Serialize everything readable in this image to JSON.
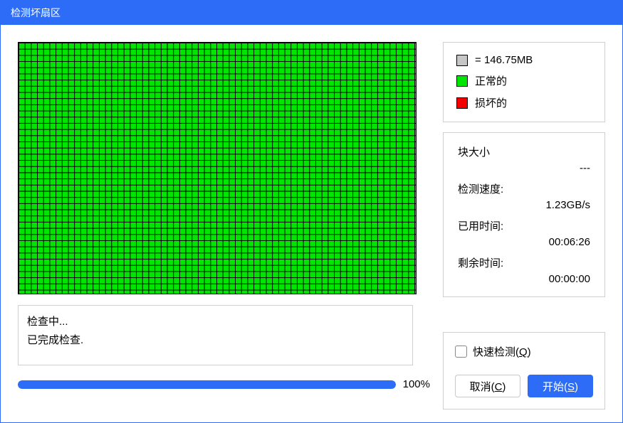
{
  "title": "检测坏扇区",
  "legend": {
    "block_size_prefix": "=",
    "block_size": "146.75MB",
    "normal": "正常的",
    "damaged": "损坏的"
  },
  "stats": {
    "block_size_label": "块大小",
    "block_size_value": "---",
    "speed_label": "检测速度:",
    "speed_value": "1.23GB/s",
    "elapsed_label": "已用时间:",
    "elapsed_value": "00:06:26",
    "remaining_label": "剩余时间:",
    "remaining_value": "00:00:00"
  },
  "status": {
    "line1": "检查中...",
    "line2": "已完成检查."
  },
  "progress": {
    "percent": 100,
    "label": "100%"
  },
  "controls": {
    "quick_check": "快速检测(",
    "quick_check_key": "Q",
    "quick_check_suffix": ")",
    "cancel": "取消(",
    "cancel_key": "C",
    "cancel_suffix": ")",
    "start": "开始(",
    "start_key": "S",
    "start_suffix": ")"
  },
  "colors": {
    "accent": "#2d6cf6",
    "good": "#00e600",
    "bad": "#f40000"
  }
}
